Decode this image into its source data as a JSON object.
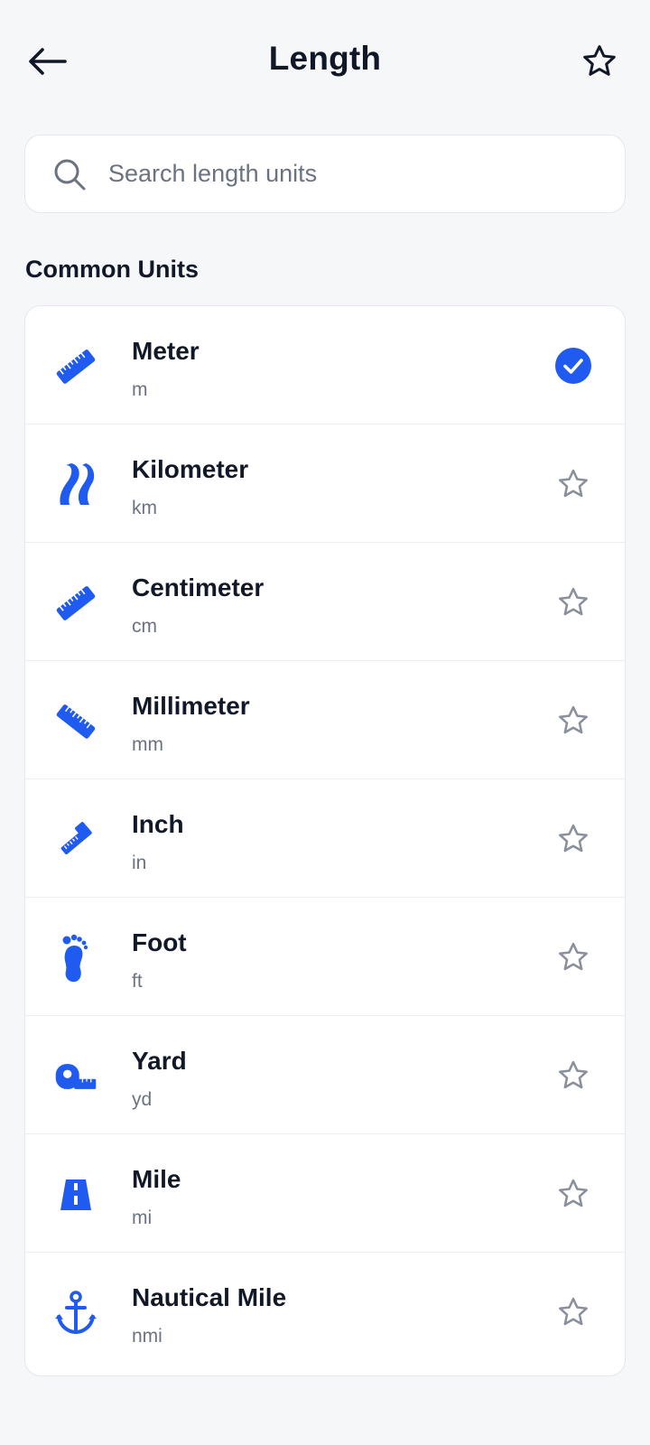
{
  "header": {
    "title": "Length",
    "back_icon": "arrow-left-icon",
    "favorite_icon": "star-outline-icon"
  },
  "search": {
    "placeholder": "Search length units",
    "value": ""
  },
  "section": {
    "title": "Common Units"
  },
  "colors": {
    "accent": "#1f5bf0",
    "text": "#111827",
    "muted": "#6b7280",
    "star": "#8a8f9c"
  },
  "units": [
    {
      "name": "Meter",
      "abbr": "m",
      "icon": "ruler-icon",
      "selected": true
    },
    {
      "name": "Kilometer",
      "abbr": "km",
      "icon": "road-icon",
      "selected": false
    },
    {
      "name": "Centimeter",
      "abbr": "cm",
      "icon": "ruler-icon",
      "selected": false
    },
    {
      "name": "Millimeter",
      "abbr": "mm",
      "icon": "ruler-icon",
      "selected": false
    },
    {
      "name": "Inch",
      "abbr": "in",
      "icon": "ruler-icon",
      "selected": false
    },
    {
      "name": "Foot",
      "abbr": "ft",
      "icon": "footprint-icon",
      "selected": false
    },
    {
      "name": "Yard",
      "abbr": "yd",
      "icon": "tape-measure-icon",
      "selected": false
    },
    {
      "name": "Mile",
      "abbr": "mi",
      "icon": "highway-icon",
      "selected": false
    },
    {
      "name": "Nautical Mile",
      "abbr": "nmi",
      "icon": "anchor-icon",
      "selected": false
    }
  ]
}
